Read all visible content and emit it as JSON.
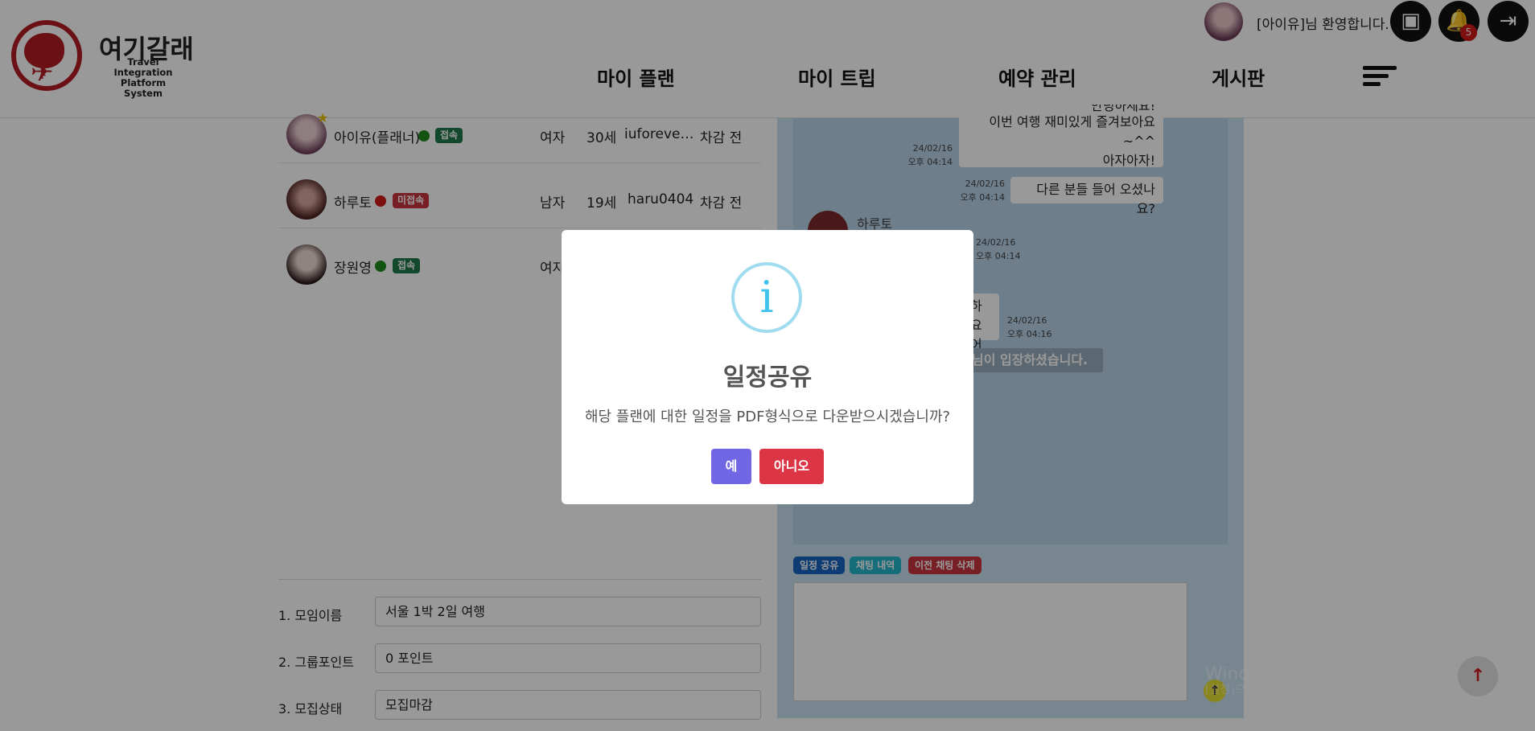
{
  "header": {
    "brand_title": "여기갈래",
    "brand_sub_1": "Travel Integration",
    "brand_sub_2": "Platform System",
    "nav": [
      "마이 플랜",
      "마이 트립",
      "예약 관리",
      "게시판"
    ],
    "welcome": "[아이유]님 환영합니다.",
    "notification_count": "5"
  },
  "members": [
    {
      "name": "아이유(플래너)",
      "status": "접속",
      "online": true,
      "gender": "여자",
      "age": "30세",
      "id": "iuforeve…",
      "fee": "차감 전"
    },
    {
      "name": "하루토",
      "status": "미접속",
      "online": false,
      "gender": "남자",
      "age": "19세",
      "id": "haru0404",
      "fee": "차감 전"
    },
    {
      "name": "장원영",
      "status": "접속",
      "online": true,
      "gender": "여자",
      "age": "",
      "id": "",
      "fee": ""
    }
  ],
  "form": {
    "fields": [
      {
        "label": "1. 모임이름",
        "value": "서울 1박 2일 여행"
      },
      {
        "label": "2. 그룹포인트",
        "value": "0 포인트"
      },
      {
        "label": "3. 모집상태",
        "value": "모집마감"
      }
    ]
  },
  "chat": {
    "msg1_line0": "안녕하세요!",
    "msg1_line1": "이번 여행 재미있게 즐겨보아요~^^",
    "msg1_line2": "아자아자!",
    "msg1_date": "24/02/16",
    "msg1_time": "오후 04:14",
    "msg2": "다른 분들 들어 오셨나요?",
    "msg2_date": "24/02/16",
    "msg2_time": "오후 04:14",
    "other_name": "하루토",
    "msg3_date": "24/02/16",
    "msg3_time": "오후 04:14",
    "msg4_line1": "하요",
    "msg4_line2": "어용",
    "msg4_date": "24/02/16",
    "msg4_time": "오후 04:16",
    "enter_note": "님이 입장하셨습니다.",
    "btn_share": "일정 공유",
    "btn_history": "채팅 내역",
    "btn_delete": "이전 채팅 삭제",
    "send_icon": "arrow-up-icon"
  },
  "watermark": {
    "line1": "Windows 정품 인증",
    "line2": "[설정]으로 이동하여 Windows를 정품 인증합니다."
  },
  "modal": {
    "icon": "info-icon",
    "title": "일정공유",
    "text": "해당 플랜에 대한 일정을 PDF형식으로 다운받으시겠습니까?",
    "confirm": "예",
    "cancel": "아니오"
  },
  "colors": {
    "brand": "#b21c24",
    "online": "#1e8a1e",
    "offline": "#d11a1a",
    "status_online": "#1f7a4a",
    "status_offline": "#c8343e",
    "confirm": "#7166e3",
    "cancel": "#dc3545",
    "btn_share": "#1565c0",
    "btn_history": "#26b6cc",
    "btn_delete": "#c8343e"
  }
}
